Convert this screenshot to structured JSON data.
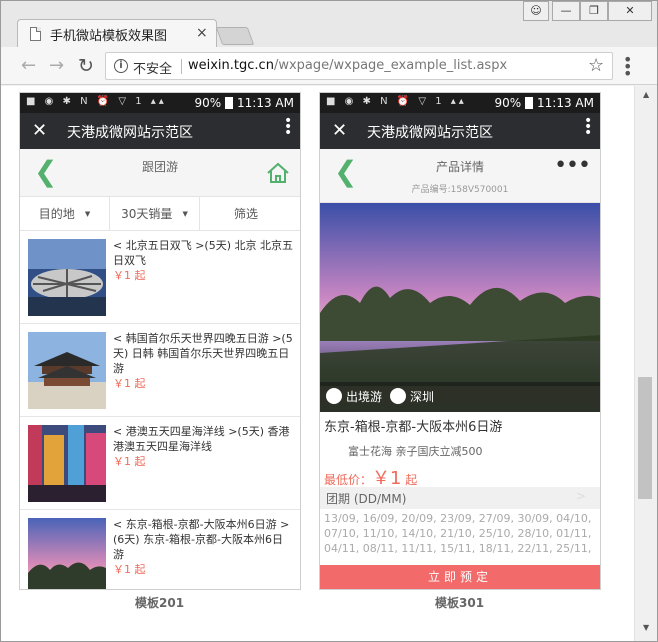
{
  "browser": {
    "tab_title": "手机微站模板效果图",
    "tab_close": "×",
    "security_label": "不安全",
    "url_host": "weixin.tgc.cn",
    "url_path": "/wxpage/wxpage_example_list.aspx",
    "icons": [
      "page-icon",
      "back-arrow-icon",
      "forward-arrow-icon",
      "reload-icon",
      "info-icon",
      "star-icon",
      "menu-icon",
      "user-icon",
      "minimize-icon",
      "maximize-icon",
      "close-icon"
    ]
  },
  "status_bar": {
    "time": "11:13 AM",
    "battery": "90%"
  },
  "template_a": {
    "wx_title": "天港成微网站示范区",
    "page_title": "跟团游",
    "filters": [
      "目的地",
      "30天销量",
      "筛选"
    ],
    "items": [
      {
        "title": "< 北京五日双飞 >(5天) 北京 北京五日双飞",
        "price": "￥1 起"
      },
      {
        "title": "< 韩国首尔乐天世界四晚五日游 >(5天) 日韩 韩国首尔乐天世界四晚五日游",
        "price": "￥1 起"
      },
      {
        "title": "< 港澳五天四星海洋线 >(5天) 香港 港澳五天四星海洋线",
        "price": "￥1 起"
      },
      {
        "title": "< 东京-箱根-京都-大阪本州6日游 >(6天) 东京-箱根-京都-大阪本州6日游",
        "price": "￥1 起"
      }
    ],
    "caption": "模板201"
  },
  "template_b": {
    "wx_title": "天港成微网站示范区",
    "page_title": "产品详情",
    "product_code": "产品编号:158V570001",
    "tags": [
      "出境游",
      "深圳"
    ],
    "product_title": "东京-箱根-京都-大阪本州6日游",
    "product_subtitle": "富士花海 亲子国庆立减500",
    "price_prefix": "最低价：",
    "price_value": "￥1",
    "price_suffix": "起",
    "group_label": "团期 (DD/MM)",
    "group_arrow": ">",
    "dates": "13/09, 16/09, 20/09, 23/09, 27/09, 30/09, 04/10, 07/10, 11/10, 14/10, 21/10, 25/10, 28/10, 01/11, 04/11, 08/11, 11/11, 15/11, 18/11, 22/11, 25/11,",
    "book_label": "立即预定",
    "caption": "模板301"
  },
  "colors": {
    "accent_green": "#53b06d",
    "price_red": "#ef6b5b",
    "button_red": "#f26a6a",
    "wechat_bar": "#2b2d30"
  }
}
